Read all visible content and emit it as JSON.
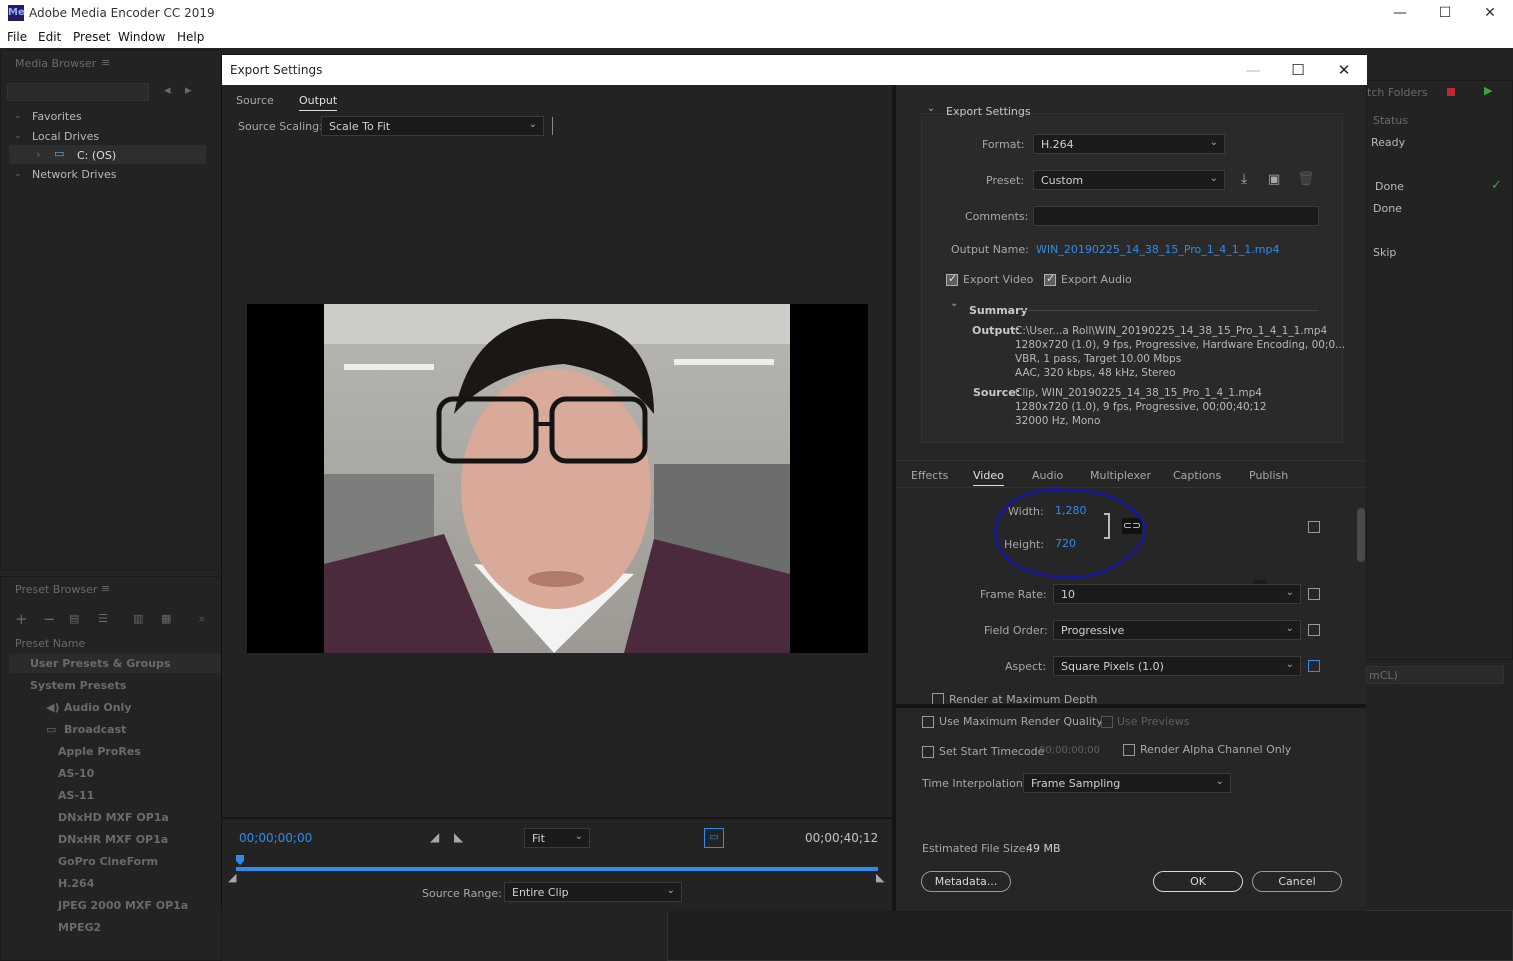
{
  "app": {
    "title": "Adobe Media Encoder CC 2019",
    "menu": [
      "File",
      "Edit",
      "Preset",
      "Window",
      "Help"
    ]
  },
  "background": {
    "media_browser_title": "Media Browser",
    "tree": [
      "Favorites",
      "Local Drives",
      "C: (OS)",
      "Network Drives"
    ],
    "preset_browser_title": "Preset Browser",
    "preset_name_header": "Preset Name",
    "presets": [
      "User Presets & Groups",
      "System Presets",
      "Audio Only",
      "Broadcast",
      "Apple ProRes",
      "AS-10",
      "AS-11",
      "DNxHD MXF OP1a",
      "DNxHR MXF OP1a",
      "GoPro CineForm",
      "H.264",
      "JPEG 2000 MXF OP1a",
      "MPEG2"
    ],
    "watch_folders_label": "tch Folders",
    "status_header": "Status",
    "status_items": [
      "Ready",
      "Done",
      "Done",
      "Skip"
    ],
    "bottom_right_field": "mCL)"
  },
  "dialog": {
    "title": "Export Settings",
    "tabs": [
      "Source",
      "Output"
    ],
    "source_scaling_label": "Source Scaling:",
    "source_scaling_value": "Scale To Fit",
    "timecode_start": "00;00;00;00",
    "timecode_end": "00;00;40;12",
    "zoom_value": "Fit",
    "source_range_label": "Source Range:",
    "source_range_value": "Entire Clip",
    "export_settings_header": "Export Settings",
    "format_label": "Format:",
    "format_value": "H.264",
    "preset_label": "Preset:",
    "preset_value": "Custom",
    "comments_label": "Comments:",
    "output_name_label": "Output Name:",
    "output_name_value": "WIN_20190225_14_38_15_Pro_1_4_1_1.mp4",
    "export_video_label": "Export Video",
    "export_audio_label": "Export Audio",
    "summary_header": "Summary",
    "summary_output_label": "Output:",
    "summary_output_lines": [
      "C:\\User...a Roll\\WIN_20190225_14_38_15_Pro_1_4_1_1.mp4",
      "1280x720 (1.0), 9 fps, Progressive, Hardware Encoding, 00;0...",
      "VBR, 1 pass, Target 10.00 Mbps",
      "AAC, 320 kbps, 48 kHz, Stereo"
    ],
    "summary_source_label": "Source:",
    "summary_source_lines": [
      "Clip, WIN_20190225_14_38_15_Pro_1_4_1.mp4",
      "1280x720 (1.0), 9 fps, Progressive, 00;00;40;12",
      "32000 Hz, Mono"
    ],
    "settings_tabs": [
      "Effects",
      "Video",
      "Audio",
      "Multiplexer",
      "Captions",
      "Publish"
    ],
    "width_label": "Width:",
    "width_value": "1,280",
    "height_label": "Height:",
    "height_value": "720",
    "frame_rate_label": "Frame Rate:",
    "frame_rate_value": "10",
    "field_order_label": "Field Order:",
    "field_order_value": "Progressive",
    "aspect_label": "Aspect:",
    "aspect_value": "Square Pixels (1.0)",
    "render_max_depth_label": "Render at Maximum Depth",
    "use_max_quality_label": "Use Maximum Render Quality",
    "use_previews_label": "Use Previews",
    "set_start_tc_label": "Set Start Timecode",
    "start_tc_value": "00;00;00;00",
    "render_alpha_label": "Render Alpha Channel Only",
    "time_interp_label": "Time Interpolation:",
    "time_interp_value": "Frame Sampling",
    "est_size_label": "Estimated File Size:",
    "est_size_value": "49 MB",
    "metadata_button": "Metadata...",
    "ok_button": "OK",
    "cancel_button": "Cancel"
  },
  "colors": {
    "accent": "#2d8ceb",
    "annotation": "#1414b4",
    "success": "#3aa63a",
    "stop": "#c0282d"
  }
}
